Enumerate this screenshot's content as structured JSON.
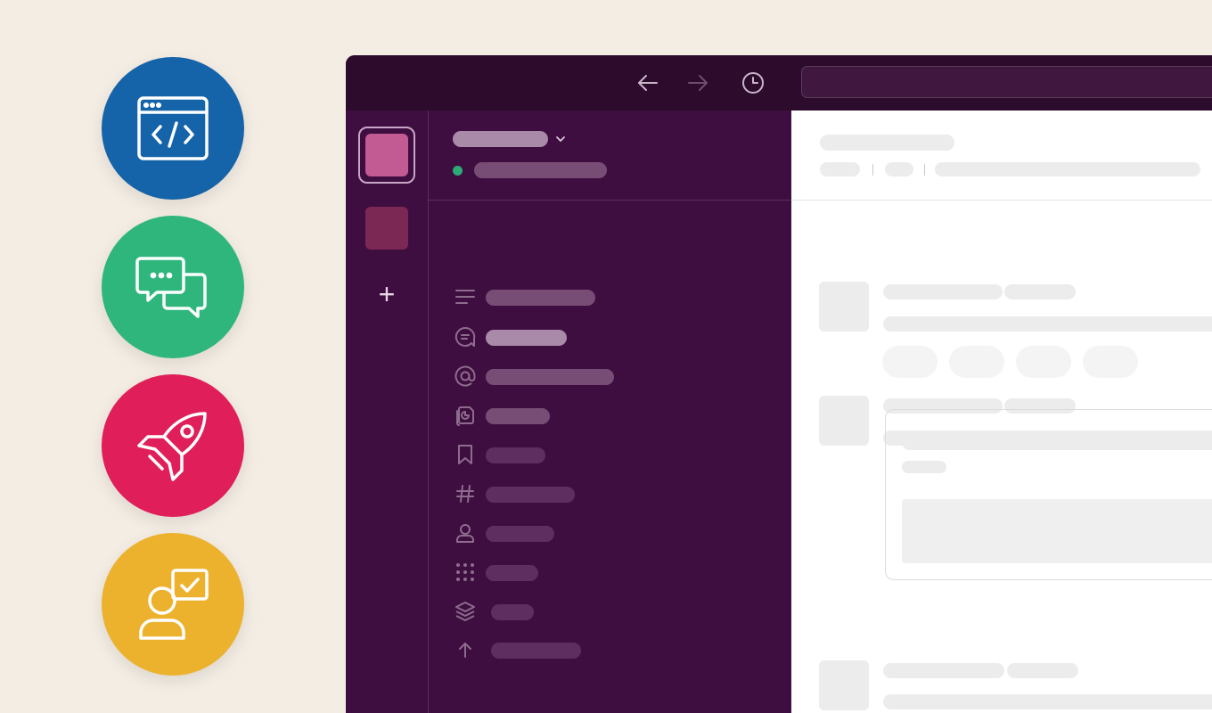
{
  "colors": {
    "background": "#f4ede4",
    "window_bg": "#3f0e40",
    "topbar_bg": "#2c0b2d",
    "workspace_active": "#c25b93",
    "workspace_secondary": "#7c2855",
    "status_online": "#2bac76",
    "feature_blue": "#1563a8",
    "feature_green": "#2eb67d",
    "feature_red": "#e01e5a",
    "feature_yellow": "#ecb22e"
  },
  "features": [
    {
      "icon": "code-window-icon"
    },
    {
      "icon": "chat-bubbles-icon"
    },
    {
      "icon": "rocket-icon"
    },
    {
      "icon": "person-checklist-icon"
    }
  ],
  "topbar": {
    "icons": [
      "back-arrow-icon",
      "forward-arrow-icon",
      "history-clock-icon"
    ]
  },
  "workspace_rail": {
    "add_label": "+"
  },
  "sidebar": {
    "items": [
      {
        "icon": "threads-icon"
      },
      {
        "icon": "dms-icon"
      },
      {
        "icon": "mentions-icon"
      },
      {
        "icon": "drafts-icon"
      },
      {
        "icon": "saved-icon"
      },
      {
        "icon": "channels-icon"
      },
      {
        "icon": "people-icon"
      },
      {
        "icon": "apps-icon"
      },
      {
        "icon": "layers-icon"
      },
      {
        "icon": "upload-arrow-icon"
      }
    ]
  }
}
